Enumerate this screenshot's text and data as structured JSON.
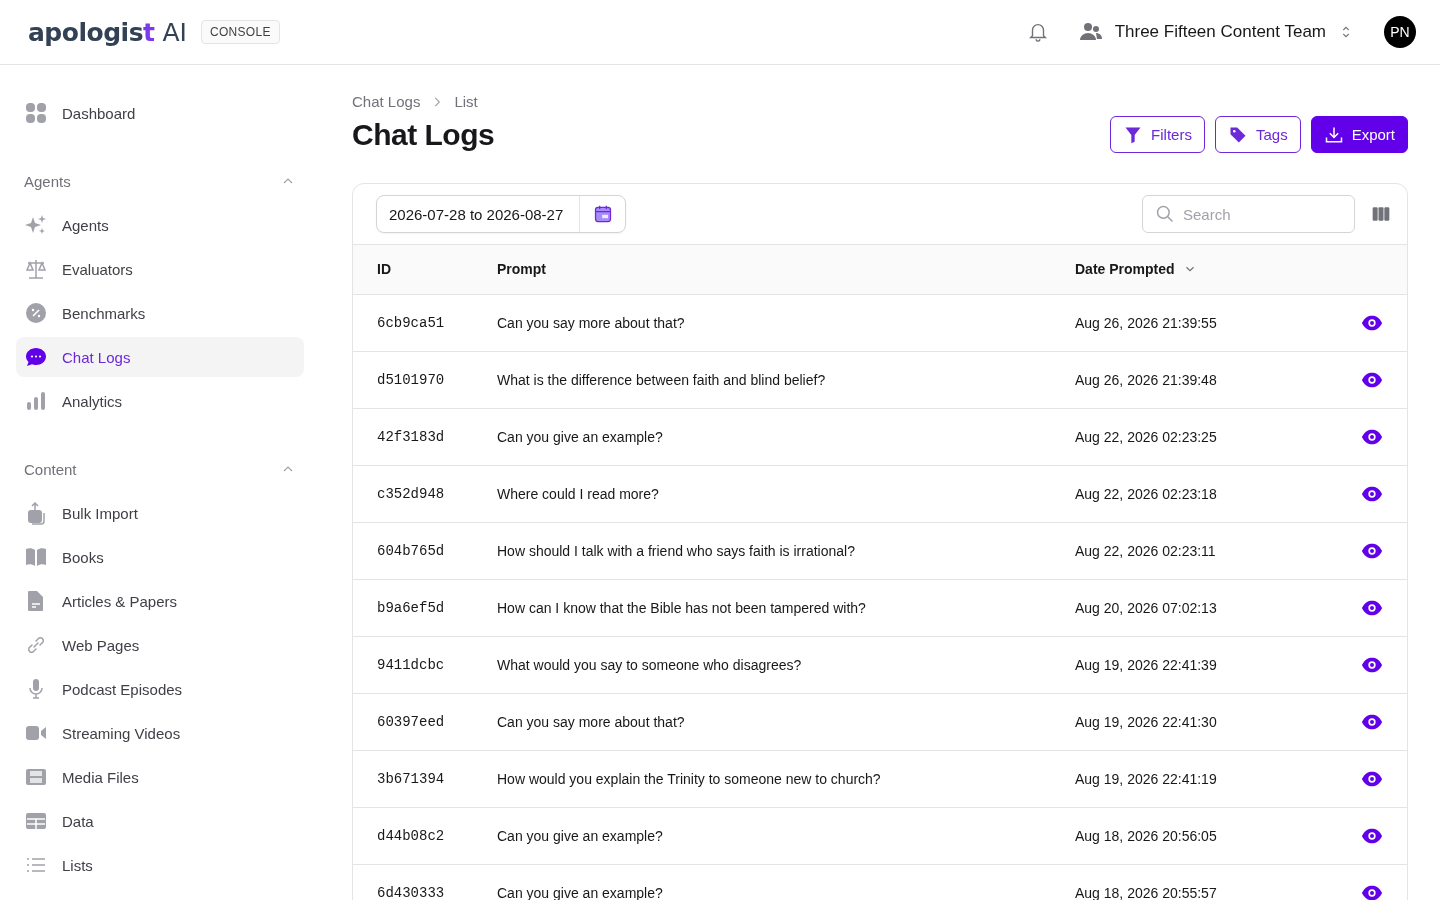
{
  "header": {
    "logo": "apologist",
    "logo_suffix": "AI",
    "badge": "CONSOLE",
    "team": "Three Fifteen Content Team",
    "avatar": "PN"
  },
  "sidebar": {
    "top": [
      {
        "label": "Dashboard",
        "selected": false
      }
    ],
    "sections": [
      {
        "title": "Agents",
        "expanded": true,
        "items": [
          {
            "label": "Agents",
            "selected": false
          },
          {
            "label": "Evaluators",
            "selected": false
          },
          {
            "label": "Benchmarks",
            "selected": false
          },
          {
            "label": "Chat Logs",
            "selected": true
          },
          {
            "label": "Analytics",
            "selected": false
          }
        ]
      },
      {
        "title": "Content",
        "expanded": true,
        "items": [
          {
            "label": "Bulk Import",
            "selected": false
          },
          {
            "label": "Books",
            "selected": false
          },
          {
            "label": "Articles & Papers",
            "selected": false
          },
          {
            "label": "Web Pages",
            "selected": false
          },
          {
            "label": "Podcast Episodes",
            "selected": false
          },
          {
            "label": "Streaming Videos",
            "selected": false
          },
          {
            "label": "Media Files",
            "selected": false
          },
          {
            "label": "Data",
            "selected": false
          },
          {
            "label": "Lists",
            "selected": false
          }
        ]
      }
    ]
  },
  "breadcrumb": [
    "Chat Logs",
    "List"
  ],
  "title": "Chat Logs",
  "actions": [
    {
      "label": "Filters",
      "kind": "outline"
    },
    {
      "label": "Tags",
      "kind": "outline"
    },
    {
      "label": "Export",
      "kind": "primary"
    }
  ],
  "date_range": "2026-07-28 to 2026-08-27",
  "search": {
    "placeholder": "Search"
  },
  "table": {
    "columns": [
      {
        "label": "ID",
        "sorted": false
      },
      {
        "label": "Prompt",
        "sorted": false
      },
      {
        "label": "Date Prompted",
        "sorted": true
      }
    ],
    "rows": [
      {
        "id": "6cb9ca51",
        "prompt": "Can you say more about that?",
        "date": "Aug 26, 2026 21:39:55"
      },
      {
        "id": "d5101970",
        "prompt": "What is the difference between faith and blind belief?",
        "date": "Aug 26, 2026 21:39:48"
      },
      {
        "id": "42f3183d",
        "prompt": "Can you give an example?",
        "date": "Aug 22, 2026 02:23:25"
      },
      {
        "id": "c352d948",
        "prompt": "Where could I read more?",
        "date": "Aug 22, 2026 02:23:18"
      },
      {
        "id": "604b765d",
        "prompt": "How should I talk with a friend who says faith is irrational?",
        "date": "Aug 22, 2026 02:23:11"
      },
      {
        "id": "b9a6ef5d",
        "prompt": "How can I know that the Bible has not been tampered with?",
        "date": "Aug 20, 2026 07:02:13"
      },
      {
        "id": "9411dcbc",
        "prompt": "What would you say to someone who disagrees?",
        "date": "Aug 19, 2026 22:41:39"
      },
      {
        "id": "60397eed",
        "prompt": "Can you say more about that?",
        "date": "Aug 19, 2026 22:41:30"
      },
      {
        "id": "3b671394",
        "prompt": "How would you explain the Trinity to someone new to church?",
        "date": "Aug 19, 2026 22:41:19"
      },
      {
        "id": "d44b08c2",
        "prompt": "Can you give an example?",
        "date": "Aug 18, 2026 20:56:05"
      },
      {
        "id": "6d430333",
        "prompt": "Can you give an example?",
        "date": "Aug 18, 2026 20:55:57"
      }
    ]
  }
}
